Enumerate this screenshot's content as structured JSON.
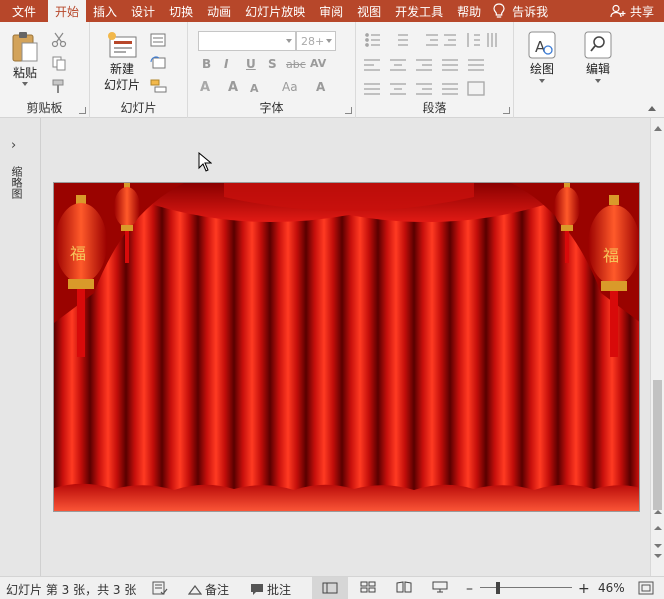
{
  "menu": {
    "file": "文件",
    "tabs": [
      "开始",
      "插入",
      "设计",
      "切换",
      "动画",
      "幻灯片放映",
      "审阅",
      "视图",
      "开发工具",
      "帮助"
    ],
    "tell_me": "告诉我",
    "share": "共享"
  },
  "ribbon": {
    "clipboard": {
      "paste_label": "粘贴",
      "group_label": "剪贴板"
    },
    "slides": {
      "new_slide_line1": "新建",
      "new_slide_line2": "幻灯片",
      "group_label": "幻灯片"
    },
    "font": {
      "font_size": "28+",
      "group_label": "字体",
      "bold": "B",
      "italic": "I",
      "underline": "U",
      "strike": "S",
      "abc": "abc",
      "av": "AV",
      "clear": "Aa"
    },
    "paragraph": {
      "group_label": "段落"
    },
    "drawing": {
      "label": "绘图"
    },
    "editing": {
      "label": "编辑"
    }
  },
  "left_pane": {
    "toggle": "›",
    "label": "缩略图"
  },
  "status": {
    "slide_info": "幻灯片 第 3 张，共 3 张",
    "notes": "备注",
    "comments": "批注",
    "zoom": "46%"
  },
  "colors": {
    "accent": "#b7472a",
    "ribbon_bg": "#f3f3f3",
    "workspace_bg": "#e6e6e6",
    "curtain_red": "#c8100c"
  }
}
